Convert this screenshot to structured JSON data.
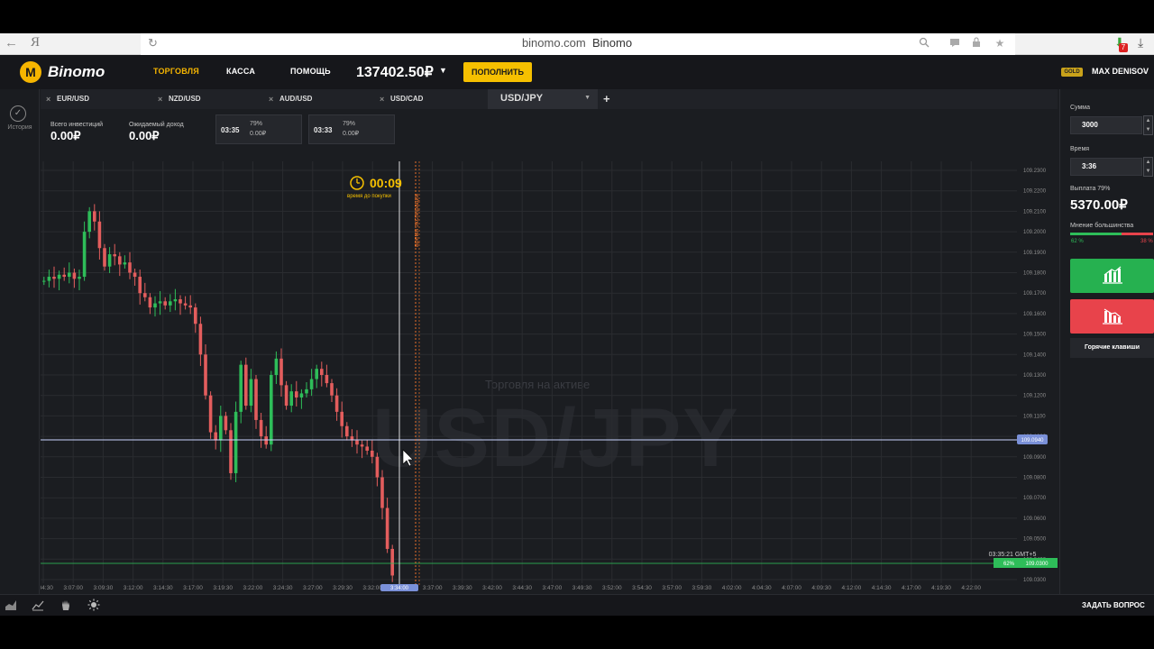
{
  "browser": {
    "back_glyph": "←",
    "ya_label": "Я",
    "domain": "binomo.com",
    "title": "Binomo",
    "download_badge": "7"
  },
  "header": {
    "logo_text": "Binomo",
    "nav": [
      "ТОРГОВЛЯ",
      "КАССА",
      "ПОМОЩЬ"
    ],
    "balance": "137402.50₽",
    "deposit_label": "ПОПОЛНИТЬ",
    "status_badge": "GOLD",
    "user": "MAX DENISOV"
  },
  "sidebar": {
    "history_label": "История"
  },
  "tabs": [
    {
      "label": "EUR/USD"
    },
    {
      "label": "NZD/USD"
    },
    {
      "label": "AUD/USD"
    },
    {
      "label": "USD/CAD"
    },
    {
      "label": "USD/JPY"
    }
  ],
  "summary": {
    "total_invest_label": "Всего инвестиций",
    "total_invest_value": "0.00₽",
    "expected_label": "Ожидаемый доход",
    "expected_value": "0.00₽"
  },
  "deals": [
    {
      "time": "03:35",
      "percent": "79%",
      "amount": "0.00₽"
    },
    {
      "time": "03:33",
      "percent": "79%",
      "amount": "0.00₽"
    }
  ],
  "chart_overlay": {
    "timer": "00:09",
    "timer_label": "время до покупки",
    "expiry_label": "время экспирации",
    "watermark_small": "Торговля на активе",
    "watermark_big": "USD/JPY",
    "server_time": "03:35:21 GMT+5",
    "current_price": "109.0940",
    "bottom_price": "109.0300",
    "bottom_percent": "62%",
    "cursor_time": "3:34:00"
  },
  "chart_data": {
    "type": "candlestick",
    "y_ticks": [
      "109.2300",
      "109.2200",
      "109.2100",
      "109.2000",
      "109.1900",
      "109.1800",
      "109.1700",
      "109.1600",
      "109.1500",
      "109.1400",
      "109.1300",
      "109.1200",
      "109.1100",
      "109.1000",
      "109.0900",
      "109.0800",
      "109.0700",
      "109.0600",
      "109.0500",
      "109.0400",
      "109.0300"
    ],
    "x_ticks": [
      "3:04:30",
      "3:07:00",
      "3:09:30",
      "3:12:00",
      "3:14:30",
      "3:17:00",
      "3:19:30",
      "3:22:00",
      "3:24:30",
      "3:27:00",
      "3:29:30",
      "3:32:00",
      "3:37:00",
      "3:39:30",
      "3:42:00",
      "3:44:30",
      "3:47:00",
      "3:49:30",
      "3:52:00",
      "3:54:30",
      "3:57:00",
      "3:59:30",
      "4:02:00",
      "4:04:30",
      "4:07:00",
      "4:09:30",
      "4:12:00",
      "4:14:30",
      "4:17:00",
      "4:19:30",
      "4:22:00"
    ],
    "colors": {
      "up": "#2ebd59",
      "down": "#e35d5d",
      "grid": "#2a2c30",
      "price_line": "#c8d4ff",
      "expiry": "#e8702a",
      "buy_line": "#ffffff"
    }
  },
  "right_panel": {
    "amount_label": "Сумма",
    "amount_value": "3000",
    "time_label": "Время",
    "time_value": "3:36",
    "payout_label": "Выплата 79%",
    "payout_value": "5370.00₽",
    "opinion_label": "Мнение большинства",
    "opinion_up": "62 %",
    "opinion_down": "38 %",
    "opinion_up_fraction": 0.62,
    "hotkeys_label": "Горячие клавиши"
  },
  "footer": {
    "ask_label": "ЗАДАТЬ ВОПРОС"
  }
}
